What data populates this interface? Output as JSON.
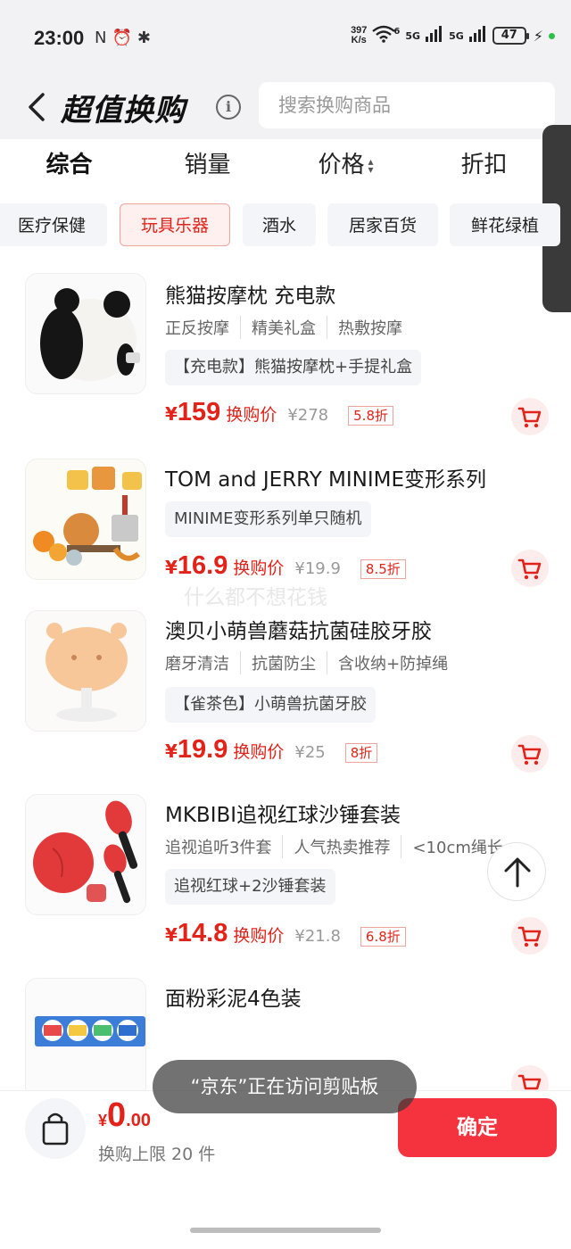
{
  "status": {
    "time": "23:00",
    "left_icons": [
      "N",
      "⏰",
      "✱"
    ],
    "net_speed_value": "397",
    "net_speed_unit": "K/s",
    "wifi_label": "6",
    "sim1": "5G",
    "sim2": "5G",
    "battery": "47"
  },
  "header": {
    "title": "超值换购",
    "info": "i",
    "search_placeholder": "搜索换购商品"
  },
  "sort_tabs": [
    {
      "label": "综合"
    },
    {
      "label": "销量"
    },
    {
      "label": "价格"
    },
    {
      "label": "折扣"
    }
  ],
  "categories": [
    {
      "label": "医疗保健"
    },
    {
      "label": "玩具乐器"
    },
    {
      "label": "酒水"
    },
    {
      "label": "居家百货"
    },
    {
      "label": "鲜花绿植"
    }
  ],
  "products": [
    {
      "title": "熊猫按摩枕 充电款",
      "tags": [
        "正反按摩",
        "精美礼盒",
        "热敷按摩"
      ],
      "spec": "【充电款】熊猫按摩枕+手提礼盒",
      "yen": "¥",
      "price": "159",
      "price_label": "换购价",
      "orig": "¥278",
      "discount": "5.8折"
    },
    {
      "title": "TOM and JERRY MINIME变形系列",
      "tags": [],
      "spec": "MINIME变形系列单只随机",
      "yen": "¥",
      "price": "16.9",
      "price_label": "换购价",
      "orig": "¥19.9",
      "discount": "8.5折"
    },
    {
      "title": "澳贝小萌兽蘑菇抗菌硅胶牙胶",
      "tags": [
        "磨牙清洁",
        "抗菌防尘",
        "含收纳+防掉绳"
      ],
      "spec": "【雀茶色】小萌兽抗菌牙胶",
      "yen": "¥",
      "price": "19.9",
      "price_label": "换购价",
      "orig": "¥25",
      "discount": "8折"
    },
    {
      "title": "MKBIBI追视红球沙锤套装",
      "tags": [
        "追视追听3件套",
        "人气热卖推荐",
        "<10cm绳长"
      ],
      "spec": "追视红球+2沙锤套装",
      "yen": "¥",
      "price": "14.8",
      "price_label": "换购价",
      "orig": "¥21.8",
      "discount": "6.8折"
    },
    {
      "title": "面粉彩泥4色装"
    }
  ],
  "watermark": "什么都不想花钱",
  "toast": "“京东”正在访问剪贴板",
  "bottom": {
    "yen": "¥",
    "total_int": "0",
    "total_dec": ".00",
    "limit": "换购上限 20 件",
    "confirm": "确定"
  },
  "colors": {
    "accent": "#e2231a",
    "confirm_bg": "#f5333f",
    "header_bg": "#f2f2f4"
  }
}
